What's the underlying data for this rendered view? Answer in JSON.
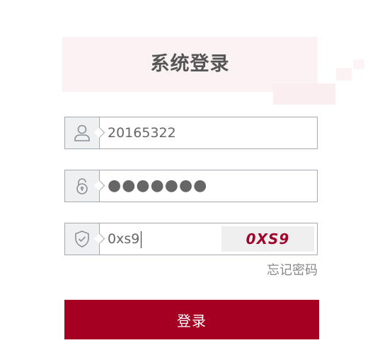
{
  "title": "系统登录",
  "username": {
    "value": "20165322",
    "icon": "user-icon"
  },
  "password": {
    "masked_value": "●●●●●●●",
    "icon": "lock-icon"
  },
  "captcha": {
    "value": "0xs9",
    "code": "0XS9",
    "icon": "shield-check-icon"
  },
  "forgot_password": "忘记密码",
  "login_button": "登录",
  "colors": {
    "accent": "#a50022",
    "captcha_text": "#a0052b",
    "border": "#a4aab0"
  }
}
